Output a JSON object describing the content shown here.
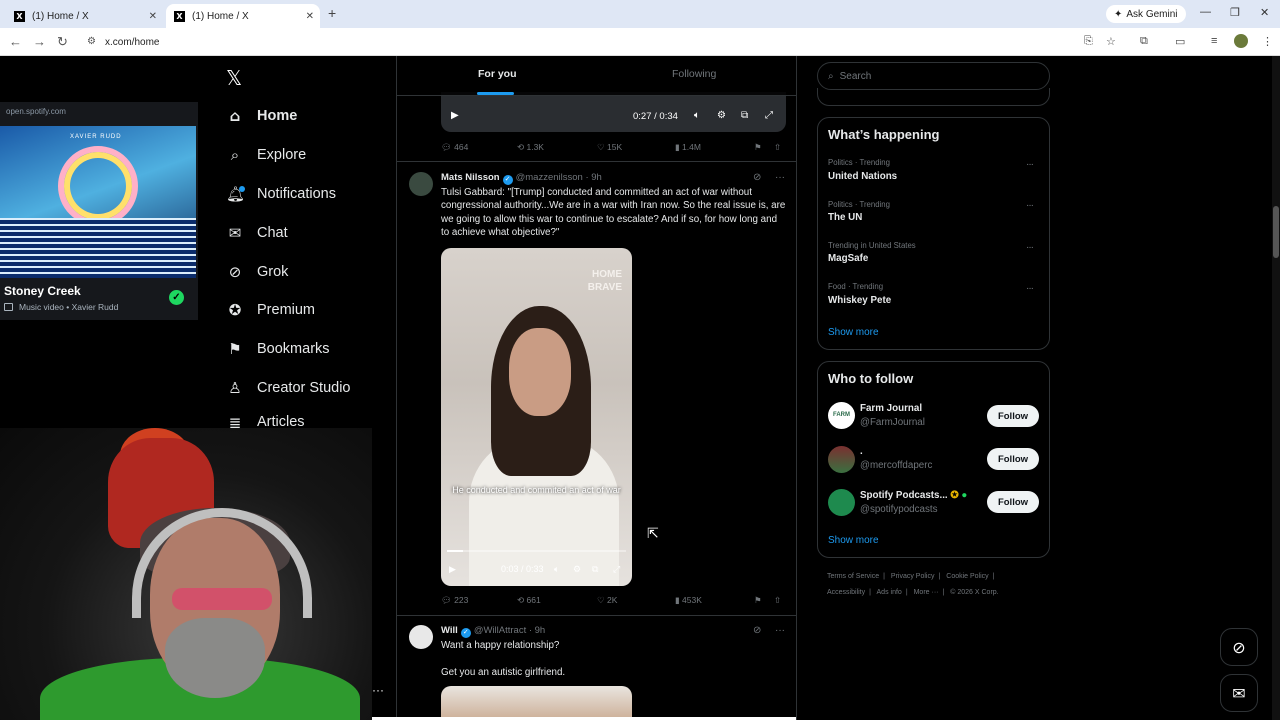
{
  "browser": {
    "tabs": [
      {
        "title": "(1) Home / X"
      },
      {
        "title": "(1) Home / X"
      }
    ],
    "gemini": "Ask Gemini",
    "url": "x.com/home"
  },
  "spotify": {
    "source": "open.spotify.com",
    "art_text": "XAVIER RUDD",
    "title": "Stoney Creek",
    "subtitle": "Music video • Xavier Rudd"
  },
  "nav": {
    "items": [
      {
        "label": "Home",
        "icon": "home-icon"
      },
      {
        "label": "Explore",
        "icon": "search-icon"
      },
      {
        "label": "Notifications",
        "icon": "bell-icon"
      },
      {
        "label": "Chat",
        "icon": "mail-icon"
      },
      {
        "label": "Grok",
        "icon": "grok-icon"
      },
      {
        "label": "Premium",
        "icon": "verified-icon"
      },
      {
        "label": "Bookmarks",
        "icon": "bookmark-icon"
      },
      {
        "label": "Creator Studio",
        "icon": "creator-icon"
      },
      {
        "label": "Articles",
        "icon": "articles-icon"
      }
    ]
  },
  "feed": {
    "tabs": {
      "for_you": "For you",
      "following": "Following"
    },
    "post1": {
      "time": "0:27 / 0:34",
      "replies": "464",
      "reposts": "1.3K",
      "likes": "15K",
      "views": "1.4M"
    },
    "post2": {
      "name": "Mats Nilsson",
      "handle": "@mazzenilsson · 9h",
      "text": "Tulsi Gabbard: \"[Trump] conducted and committed an act of war without congressional authority...We are in a war with Iran now. So the real issue is, are we going to allow this war to continue to escalate? And if so, for how long and to achieve what objective?\"",
      "watermark": "HOME\nBRAVE",
      "caption": "He conducted and commited an act of war",
      "time": "0:03 / 0:33",
      "progress": 0.09,
      "replies": "223",
      "reposts": "661",
      "likes": "2K",
      "views": "453K"
    },
    "post3": {
      "name": "Will",
      "handle": "@WillAttract · 9h",
      "line1": "Want a happy relationship?",
      "line2": "Get you an autistic girlfriend."
    }
  },
  "right": {
    "search_placeholder": "Search",
    "happening_title": "What’s happening",
    "trends": [
      {
        "cat": "Politics · Trending",
        "name": "United Nations"
      },
      {
        "cat": "Politics · Trending",
        "name": "The UN"
      },
      {
        "cat": "Trending in United States",
        "name": "MagSafe"
      },
      {
        "cat": "Food · Trending",
        "name": "Whiskey Pete"
      }
    ],
    "show_more": "Show more",
    "who_title": "Who to follow",
    "follow": [
      {
        "name": "Farm Journal",
        "handle": "@FarmJournal",
        "avatar_text": "FARM"
      },
      {
        "name": ".",
        "handle": "@mercoffdaperc",
        "avatar_text": ""
      },
      {
        "name": "Spotify Podcasts...",
        "handle": "@spotifypodcasts",
        "avatar_text": ""
      }
    ],
    "follow_label": "Follow",
    "footer": [
      "Terms of Service",
      "Privacy Policy",
      "Cookie Policy",
      "Accessibility",
      "Ads info",
      "More ···",
      "© 2026 X Corp."
    ]
  }
}
